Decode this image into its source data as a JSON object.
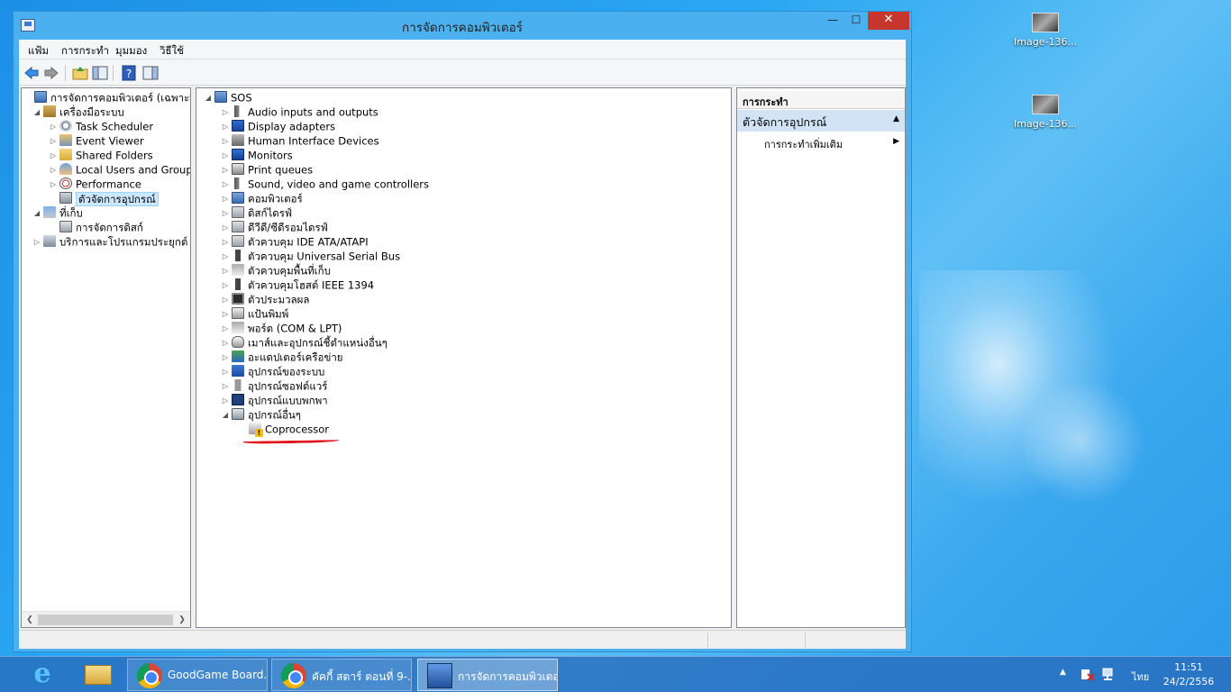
{
  "desktop": {
    "icons": [
      {
        "label": "Image-136..."
      },
      {
        "label": "Image-136..."
      }
    ]
  },
  "window": {
    "title": "การจัดการคอมพิวเตอร์",
    "controls": {
      "minimize": "—",
      "maximize": "☐",
      "close": "✕"
    }
  },
  "menu": [
    "แฟ้ม",
    "การกระทำ",
    "มุมมอง",
    "วิธีใช้"
  ],
  "left_tree": [
    {
      "label": "การจัดการคอมพิวเตอร์ (เฉพาะที่)",
      "level": 0,
      "arrow": "",
      "icon": "computer-icon"
    },
    {
      "label": "เครื่องมือระบบ",
      "level": 1,
      "arrow": "◢",
      "icon": "tools-icon"
    },
    {
      "label": "Task Scheduler",
      "level": 2,
      "arrow": "▷",
      "icon": "clock-icon"
    },
    {
      "label": "Event Viewer",
      "level": 2,
      "arrow": "▷",
      "icon": "event-viewer-icon"
    },
    {
      "label": "Shared Folders",
      "level": 2,
      "arrow": "▷",
      "icon": "shared-folder-icon"
    },
    {
      "label": "Local Users and Groups",
      "level": 2,
      "arrow": "▷",
      "icon": "users-icon"
    },
    {
      "label": "Performance",
      "level": 2,
      "arrow": "▷",
      "icon": "performance-icon"
    },
    {
      "label": "ตัวจัดการอุปกรณ์",
      "level": 2,
      "arrow": "",
      "icon": "device-manager-icon",
      "selected": true
    },
    {
      "label": "ที่เก็บ",
      "level": 1,
      "arrow": "◢",
      "icon": "storage-icon"
    },
    {
      "label": "การจัดการดิสก์",
      "level": 2,
      "arrow": "",
      "icon": "disk-icon"
    },
    {
      "label": "บริการและโปรแกรมประยุกต์",
      "level": 1,
      "arrow": "▷",
      "icon": "services-icon"
    }
  ],
  "device_tree": {
    "root": "SOS",
    "items": [
      {
        "label": "Audio inputs and outputs",
        "icon": "audio-icon"
      },
      {
        "label": "Display adapters",
        "icon": "display-adapter-icon"
      },
      {
        "label": "Human Interface Devices",
        "icon": "hid-icon"
      },
      {
        "label": "Monitors",
        "icon": "monitor-icon"
      },
      {
        "label": "Print queues",
        "icon": "printer-icon"
      },
      {
        "label": "Sound, video and game controllers",
        "icon": "sound-icon"
      },
      {
        "label": "คอมพิวเตอร์",
        "icon": "computer-icon"
      },
      {
        "label": "ดิสก์ไดรฟ์",
        "icon": "disk-drive-icon"
      },
      {
        "label": "ดีวีดี/ซีดีรอมไดรฟ์",
        "icon": "dvd-drive-icon"
      },
      {
        "label": "ตัวควบคุม IDE ATA/ATAPI",
        "icon": "ide-controller-icon"
      },
      {
        "label": "ตัวควบคุม Universal Serial Bus",
        "icon": "usb-icon"
      },
      {
        "label": "ตัวควบคุมพื้นที่เก็บ",
        "icon": "storage-controller-icon"
      },
      {
        "label": "ตัวควบคุมโฮสต์ IEEE 1394",
        "icon": "ieee1394-icon"
      },
      {
        "label": "ตัวประมวลผล",
        "icon": "processor-icon"
      },
      {
        "label": "แป้นพิมพ์",
        "icon": "keyboard-icon"
      },
      {
        "label": "พอร์ต (COM & LPT)",
        "icon": "port-icon"
      },
      {
        "label": "เมาส์และอุปกรณ์ชี้ตำแหน่งอื่นๆ",
        "icon": "mouse-icon"
      },
      {
        "label": "อะแดปเตอร์เครือข่าย",
        "icon": "network-adapter-icon"
      },
      {
        "label": "อุปกรณ์ของระบบ",
        "icon": "system-device-icon"
      },
      {
        "label": "อุปกรณ์ซอฟต์แวร์",
        "icon": "software-device-icon"
      },
      {
        "label": "อุปกรณ์แบบพกพา",
        "icon": "portable-device-icon"
      },
      {
        "label": "อุปกรณ์อื่นๆ",
        "icon": "other-devices-icon",
        "expanded": true
      }
    ],
    "child": "Coprocessor"
  },
  "actions": {
    "header": "การกระทำ",
    "section": "ตัวจัดการอุปกรณ์",
    "more": "การกระทำเพิ่มเติม"
  },
  "taskbar": {
    "tasks": [
      {
        "label": "GoodGame Board..."
      },
      {
        "label": "คัคกี้ สตาร์ ตอนที่ 9-..."
      },
      {
        "label": "การจัดการคอมพิวเตอร์"
      }
    ],
    "tray_lang": "ไทย",
    "time": "11:51",
    "date": "24/2/2556"
  },
  "colors": {
    "accent": "#4ab0f0",
    "close_button": "#c7362d",
    "annotation_line": "#e0161b",
    "selection": "#cce8ff"
  }
}
